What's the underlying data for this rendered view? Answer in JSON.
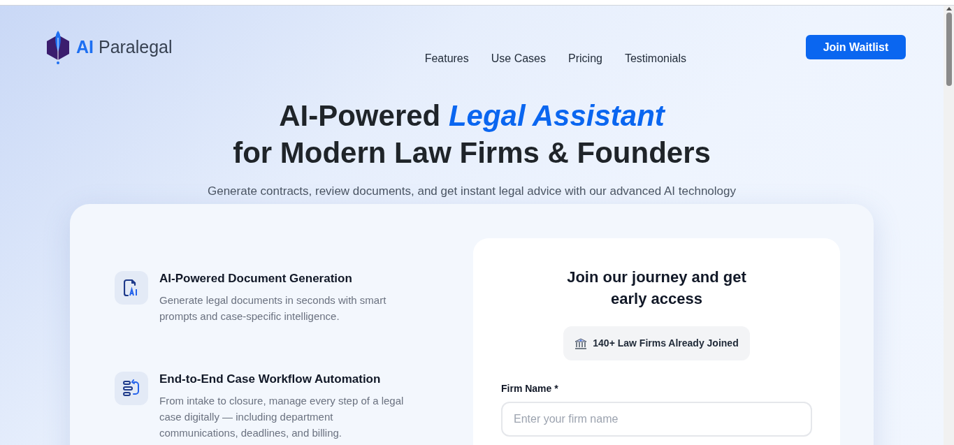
{
  "header": {
    "logo": {
      "accent": "AI",
      "name": "Paralegal"
    },
    "nav": [
      "Features",
      "Use Cases",
      "Pricing",
      "Testimonials"
    ],
    "cta": "Join Waitlist"
  },
  "hero": {
    "title_start": "AI-Powered",
    "title_highlight": "Legal Assistant",
    "title_line2": "for Modern Law Firms & Founders",
    "subtitle": "Generate contracts, review documents, and get instant legal advice with our advanced AI technology"
  },
  "features": [
    {
      "kind": "document",
      "title": "AI-Powered Document Generation",
      "description": "Generate legal documents in seconds with smart prompts and case-specific intelligence."
    },
    {
      "kind": "workflow",
      "title": "End-to-End Case Workflow Automation",
      "description": "From intake to closure, manage every step of a legal case digitally — including department communications, deadlines, and billing."
    }
  ],
  "signup": {
    "title": "Join our journey and get early access",
    "badge": "140+ Law Firms Already Joined",
    "fields": [
      {
        "label": "Firm Name *",
        "placeholder": "Enter your firm name"
      }
    ]
  }
}
